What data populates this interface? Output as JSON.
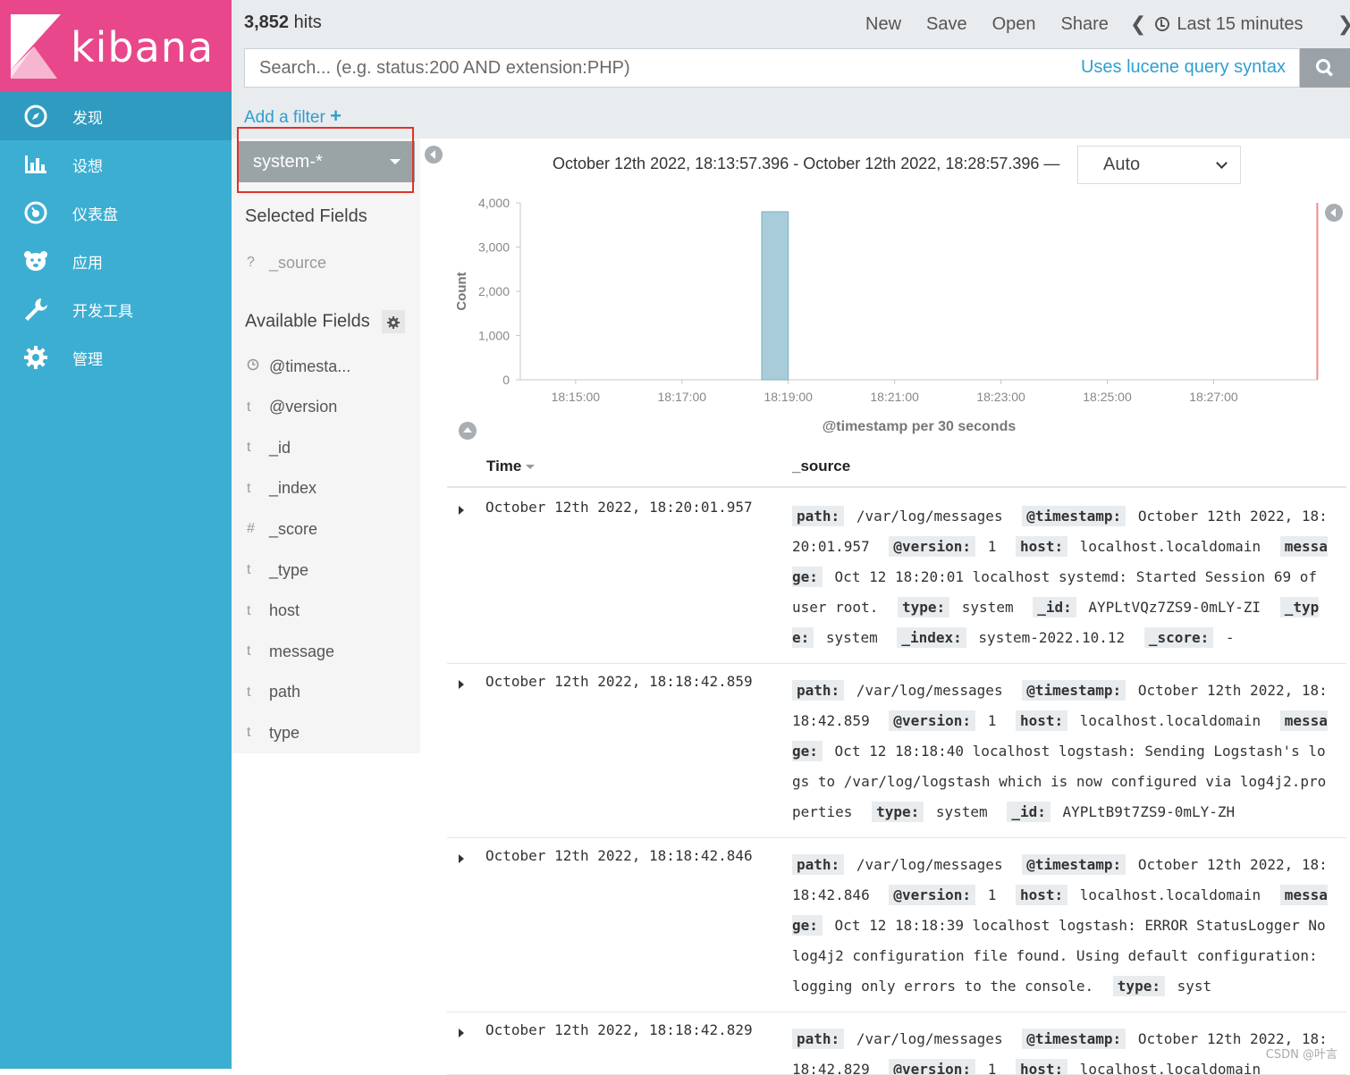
{
  "nav": {
    "logo_text": "kibana",
    "items": [
      {
        "label": "发现",
        "icon": "compass-icon"
      },
      {
        "label": "设想",
        "icon": "bar-chart-icon"
      },
      {
        "label": "仪表盘",
        "icon": "gauge-icon"
      },
      {
        "label": "应用",
        "icon": "bear-icon"
      },
      {
        "label": "开发工具",
        "icon": "wrench-icon"
      },
      {
        "label": "管理",
        "icon": "gear-icon"
      }
    ]
  },
  "topbar": {
    "hits_count": "3,852",
    "hits_label": "hits",
    "menu": [
      "New",
      "Save",
      "Open",
      "Share"
    ],
    "time_label": "Last 15 minutes",
    "search_placeholder": "Search... (e.g. status:200 AND extension:PHP)",
    "lucene_link": "Uses lucene query syntax",
    "add_filter": "Add a filter"
  },
  "sidebar": {
    "index_pattern": "system-*",
    "selected_title": "Selected Fields",
    "selected_fields": [
      {
        "type": "?",
        "name": "_source"
      }
    ],
    "available_title": "Available Fields",
    "available_fields": [
      {
        "type": "clock",
        "name": "@timesta..."
      },
      {
        "type": "t",
        "name": "@version"
      },
      {
        "type": "t",
        "name": "_id"
      },
      {
        "type": "t",
        "name": "_index"
      },
      {
        "type": "#",
        "name": "_score"
      },
      {
        "type": "t",
        "name": "_type"
      },
      {
        "type": "t",
        "name": "host"
      },
      {
        "type": "t",
        "name": "message"
      },
      {
        "type": "t",
        "name": "path"
      },
      {
        "type": "t",
        "name": "type"
      }
    ]
  },
  "main": {
    "range_text": "October 12th 2022, 18:13:57.396 - October 12th 2022, 18:28:57.396 —",
    "interval": "Auto",
    "table_headers": {
      "time": "Time",
      "source": "_source"
    },
    "rows": [
      {
        "time": "October 12th 2022, 18:20:01.957",
        "fields": [
          {
            "k": "path:",
            "v": "/var/log/messages"
          },
          {
            "k": "@timestamp:",
            "v": "October 12th 2022, 18:20:01.957"
          },
          {
            "k": "@version:",
            "v": "1"
          },
          {
            "k": "host:",
            "v": "localhost.localdomain"
          },
          {
            "k": "message:",
            "v": "Oct 12 18:20:01 localhost systemd: Started Session 69 of user root."
          },
          {
            "k": "type:",
            "v": "system"
          },
          {
            "k": "_id:",
            "v": "AYPLtVQz7ZS9-0mLY-ZI"
          },
          {
            "k": "_type:",
            "v": "system"
          },
          {
            "k": "_index:",
            "v": "system-2022.10.12"
          },
          {
            "k": "_score:",
            "v": "-"
          }
        ]
      },
      {
        "time": "October 12th 2022, 18:18:42.859",
        "fields": [
          {
            "k": "path:",
            "v": "/var/log/messages"
          },
          {
            "k": "@timestamp:",
            "v": "October 12th 2022, 18:18:42.859"
          },
          {
            "k": "@version:",
            "v": "1"
          },
          {
            "k": "host:",
            "v": "localhost.localdomain"
          },
          {
            "k": "message:",
            "v": "Oct 12 18:18:40 localhost logstash: Sending Logstash's logs to /var/log/logstash which is now configured via log4j2.properties"
          },
          {
            "k": "type:",
            "v": "system"
          },
          {
            "k": "_id:",
            "v": "AYPLtB9t7ZS9-0mLY-ZH"
          }
        ]
      },
      {
        "time": "October 12th 2022, 18:18:42.846",
        "fields": [
          {
            "k": "path:",
            "v": "/var/log/messages"
          },
          {
            "k": "@timestamp:",
            "v": "October 12th 2022, 18:18:42.846"
          },
          {
            "k": "@version:",
            "v": "1"
          },
          {
            "k": "host:",
            "v": "localhost.localdomain"
          },
          {
            "k": "message:",
            "v": "Oct 12 18:18:39 localhost logstash: ERROR StatusLogger No log4j2 configuration file found. Using default configuration: logging only errors to the console."
          },
          {
            "k": "type:",
            "v": "syst"
          }
        ]
      },
      {
        "time": "October 12th 2022, 18:18:42.829",
        "fields": [
          {
            "k": "path:",
            "v": "/var/log/messages"
          },
          {
            "k": "@timestamp:",
            "v": "October 12th 2022, 18:18:42.829"
          },
          {
            "k": "@version:",
            "v": "1"
          },
          {
            "k": "host:",
            "v": "localhost.localdomain"
          }
        ]
      }
    ]
  },
  "chart_data": {
    "type": "bar",
    "ylabel": "Count",
    "xlabel": "@timestamp per 30 seconds",
    "ylim": [
      0,
      4000
    ],
    "yticks": [
      "0",
      "1,000",
      "2,000",
      "3,000",
      "4,000"
    ],
    "xticks": [
      "18:15:00",
      "18:17:00",
      "18:19:00",
      "18:21:00",
      "18:23:00",
      "18:25:00",
      "18:27:00"
    ],
    "x_start_min": 13.96,
    "x_end_min": 28.96,
    "bars": [
      {
        "x": "18:18:30",
        "value": 3800
      }
    ],
    "bar_color": "#a8ccd8",
    "now_marker": "18:28:57"
  },
  "watermark": "CSDN @叶言"
}
